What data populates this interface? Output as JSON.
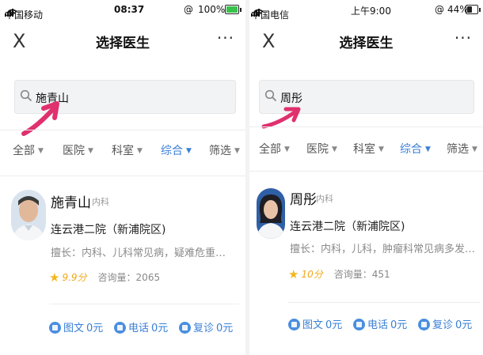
{
  "left": {
    "status": {
      "carrier": "中国移动",
      "time": "08:37",
      "battery_pct": "100%"
    },
    "nav": {
      "close_glyph": "X",
      "title": "选择医生",
      "more_glyph": "···"
    },
    "search": {
      "value": "施青山"
    },
    "filters": [
      {
        "label": "全部"
      },
      {
        "label": "医院"
      },
      {
        "label": "科室"
      },
      {
        "label": "综合",
        "active": true
      },
      {
        "label": "筛选"
      }
    ],
    "doctor": {
      "name": "施青山",
      "dept": "内科",
      "hospital": "连云港二院（新浦院区)",
      "specialty": "擅长：内科、儿科常见病，疑难危重病诊...",
      "score": "9.9分",
      "consult": "咨询量：2065",
      "services": [
        {
          "label": "图文",
          "price": "0元"
        },
        {
          "label": "电话",
          "price": "0元"
        },
        {
          "label": "复诊",
          "price": "0元"
        }
      ]
    }
  },
  "right": {
    "status": {
      "carrier": "中国电信",
      "time": "上午9:00",
      "battery_pct": "44%"
    },
    "nav": {
      "close_glyph": "X",
      "title": "选择医生",
      "more_glyph": "···"
    },
    "search": {
      "value": "周彤"
    },
    "filters": [
      {
        "label": "全部"
      },
      {
        "label": "医院"
      },
      {
        "label": "科室"
      },
      {
        "label": "综合",
        "active": true
      },
      {
        "label": "筛选"
      }
    ],
    "doctor": {
      "name": "周彤",
      "dept": "内科",
      "hospital": "连云港二院（新浦院区)",
      "specialty": "擅长：内科，儿科，肿瘤科常见病多发病诊治",
      "score": "10分",
      "consult": "咨询量：451",
      "services": [
        {
          "label": "图文",
          "price": "0元"
        },
        {
          "label": "电话",
          "price": "0元"
        },
        {
          "label": "复诊",
          "price": "0元"
        }
      ]
    }
  },
  "colors": {
    "accent": "#3a7fd5",
    "annotation_arrow": "#e0306e",
    "star": "#f6b61c",
    "battery_left": "#39c24b",
    "battery_right": "#222222"
  },
  "icons": [
    "close-icon",
    "more-icon",
    "search-icon",
    "star-icon",
    "caret-down-icon",
    "chat-icon",
    "phone-icon",
    "revisit-icon",
    "wifi-icon",
    "signal-icon",
    "battery-icon"
  ]
}
